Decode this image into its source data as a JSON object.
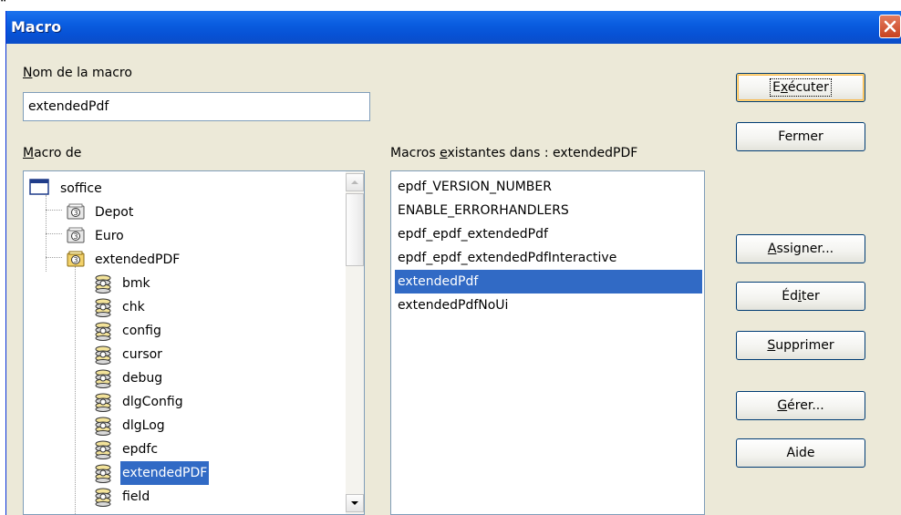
{
  "window": {
    "title": "Macro",
    "close_icon": "close-icon"
  },
  "macro_name": {
    "label_prefix": "N",
    "label_rest": "om de la macro",
    "value": "extendedPdf"
  },
  "macro_from": {
    "label_prefix": "M",
    "label_rest": "acro de",
    "tree": [
      {
        "label": "soffice",
        "icon": "window-icon",
        "level": 0
      },
      {
        "label": "Depot",
        "icon": "library-icon",
        "level": 1
      },
      {
        "label": "Euro",
        "icon": "library-icon",
        "level": 1
      },
      {
        "label": "extendedPDF",
        "icon": "library-open-icon",
        "level": 1
      },
      {
        "label": "bmk",
        "icon": "module-icon",
        "level": 2
      },
      {
        "label": "chk",
        "icon": "module-icon",
        "level": 2
      },
      {
        "label": "config",
        "icon": "module-icon",
        "level": 2
      },
      {
        "label": "cursor",
        "icon": "module-icon",
        "level": 2
      },
      {
        "label": "debug",
        "icon": "module-icon",
        "level": 2
      },
      {
        "label": "dlgConfig",
        "icon": "module-icon",
        "level": 2
      },
      {
        "label": "dlgLog",
        "icon": "module-icon",
        "level": 2
      },
      {
        "label": "epdfc",
        "icon": "module-icon",
        "level": 2
      },
      {
        "label": "extendedPDF",
        "icon": "module-icon",
        "level": 2,
        "selected": true
      },
      {
        "label": "field",
        "icon": "module-icon",
        "level": 2
      }
    ]
  },
  "existing": {
    "label_pre": "Macros ",
    "label_ul": "e",
    "label_post": "xistantes dans : extendedPDF",
    "items": [
      "epdf_VERSION_NUMBER",
      "ENABLE_ERRORHANDLERS",
      "epdf_epdf_extendedPdf",
      "epdf_epdf_extendedPdfInteractive",
      "extendedPdf",
      "extendedPdfNoUi"
    ],
    "selected_index": 4
  },
  "buttons": {
    "execute": {
      "pre": "E",
      "ul": "x",
      "post": "écuter"
    },
    "close": {
      "label": "Fermer"
    },
    "assign": {
      "pre": "",
      "ul": "A",
      "post": "ssigner..."
    },
    "edit": {
      "pre": "Éd",
      "ul": "i",
      "post": "ter"
    },
    "delete": {
      "pre": "",
      "ul": "S",
      "post": "upprimer"
    },
    "manage": {
      "pre": "",
      "ul": "G",
      "post": "érer..."
    },
    "help": {
      "label": "Aide"
    }
  },
  "colors": {
    "titlebar": "#0a5de0",
    "selection": "#316ac5",
    "dialog_bg": "#ece9d8"
  }
}
